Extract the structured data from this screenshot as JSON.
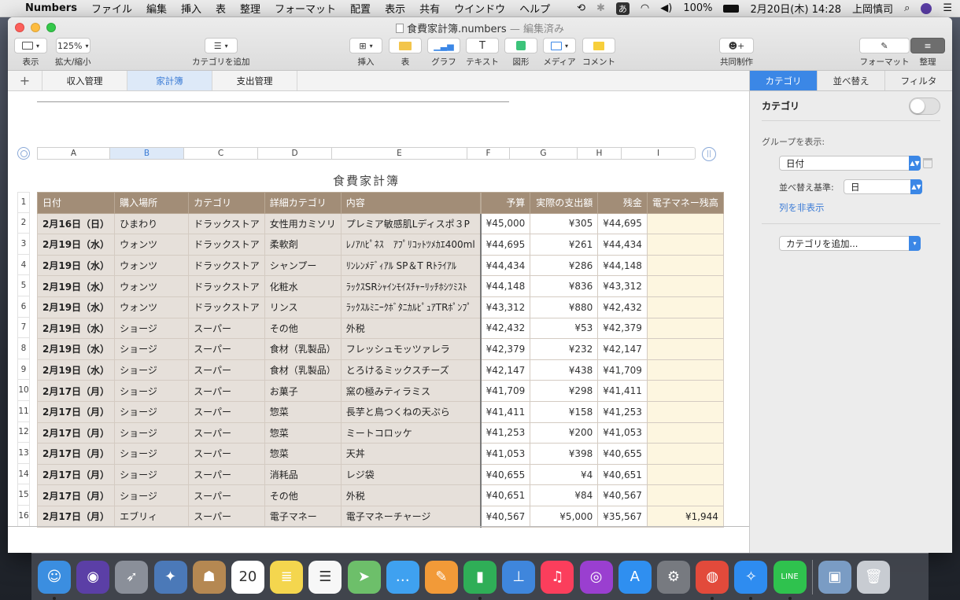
{
  "menubar": {
    "app": "Numbers",
    "items": [
      "ファイル",
      "編集",
      "挿入",
      "表",
      "整理",
      "フォーマット",
      "配置",
      "表示",
      "共有",
      "ウインドウ",
      "ヘルプ"
    ],
    "input_mode": "あ",
    "battery": "100%",
    "datetime": "2月20日(木)  14:28",
    "user": "上岡慎司"
  },
  "window": {
    "title": "食費家計簿.numbers",
    "status": " — 編集済み",
    "toolbar": {
      "view": "表示",
      "zoom_value": "125%",
      "zoom": "拡大/縮小",
      "add_category": "カテゴリを追加",
      "insert": "挿入",
      "table": "表",
      "chart": "グラフ",
      "text": "テキスト",
      "shape": "図形",
      "media": "メディア",
      "comment": "コメント",
      "collaborate": "共同制作",
      "format": "フォーマット",
      "organize": "整理"
    }
  },
  "sheets": [
    {
      "label": "収入管理"
    },
    {
      "label": "家計簿"
    },
    {
      "label": "支出管理"
    }
  ],
  "columns": [
    "A",
    "B",
    "C",
    "D",
    "E",
    "F",
    "G",
    "H",
    "I"
  ],
  "table": {
    "title": "食費家計簿",
    "headers": [
      "日付",
      "購入場所",
      "カテゴリ",
      "詳細カテゴリ",
      "内容",
      "予算",
      "実際の支出額",
      "残金",
      "電子マネー残高"
    ],
    "rows": [
      [
        "2月16日（日）",
        "ひまわり",
        "ドラックストア",
        "女性用カミソリ",
        "プレミア敏感肌Lディスポ３P",
        "¥45,000",
        "¥305",
        "¥44,695",
        ""
      ],
      [
        "2月19日（水）",
        "ウォンツ",
        "ドラックストア",
        "柔軟剤",
        "ﾚﾉｱﾊﾋﾟﾈｽ　ｱﾌﾟﾘｺｯﾄﾂﾒｶｴ400ml",
        "¥44,695",
        "¥261",
        "¥44,434",
        ""
      ],
      [
        "2月19日（水）",
        "ウォンツ",
        "ドラックストア",
        "シャンプー",
        "ﾘﾝﾚﾝﾒﾃﾞｨｱﾙ SP＆T Rﾄﾗｲｱﾙ",
        "¥44,434",
        "¥286",
        "¥44,148",
        ""
      ],
      [
        "2月19日（水）",
        "ウォンツ",
        "ドラックストア",
        "化粧水",
        "ﾗｯｸｽSRｼｬｲﾝﾓｲｽﾁｬｰﾘｯﾁﾎｼﾂﾐｽﾄ",
        "¥44,148",
        "¥836",
        "¥43,312",
        ""
      ],
      [
        "2月19日（水）",
        "ウォンツ",
        "ドラックストア",
        "リンス",
        "ﾗｯｸｽﾙﾐﾆｰｸﾎﾞﾀﾆｶﾙﾋﾟｭｱTRﾎﾟﾝﾌﾟ",
        "¥43,312",
        "¥880",
        "¥42,432",
        ""
      ],
      [
        "2月19日（水）",
        "ショージ",
        "スーパー",
        "その他",
        "外税",
        "¥42,432",
        "¥53",
        "¥42,379",
        ""
      ],
      [
        "2月19日（水）",
        "ショージ",
        "スーパー",
        "食材（乳製品）",
        "フレッシュモッツァレラ",
        "¥42,379",
        "¥232",
        "¥42,147",
        ""
      ],
      [
        "2月19日（水）",
        "ショージ",
        "スーパー",
        "食材（乳製品）",
        "とろけるミックスチーズ",
        "¥42,147",
        "¥438",
        "¥41,709",
        ""
      ],
      [
        "2月17日（月）",
        "ショージ",
        "スーパー",
        "お菓子",
        "窯の極みティラミス",
        "¥41,709",
        "¥298",
        "¥41,411",
        ""
      ],
      [
        "2月17日（月）",
        "ショージ",
        "スーパー",
        "惣菜",
        "長芋と鳥つくねの天ぷら",
        "¥41,411",
        "¥158",
        "¥41,253",
        ""
      ],
      [
        "2月17日（月）",
        "ショージ",
        "スーパー",
        "惣菜",
        "ミートコロッケ",
        "¥41,253",
        "¥200",
        "¥41,053",
        ""
      ],
      [
        "2月17日（月）",
        "ショージ",
        "スーパー",
        "惣菜",
        "天丼",
        "¥41,053",
        "¥398",
        "¥40,655",
        ""
      ],
      [
        "2月17日（月）",
        "ショージ",
        "スーパー",
        "消耗品",
        "レジ袋",
        "¥40,655",
        "¥4",
        "¥40,651",
        ""
      ],
      [
        "2月17日（月）",
        "ショージ",
        "スーパー",
        "その他",
        "外税",
        "¥40,651",
        "¥84",
        "¥40,567",
        ""
      ],
      [
        "2月17日（月）",
        "エブリィ",
        "スーパー",
        "電子マネー",
        "電子マネーチャージ",
        "¥40,567",
        "¥5,000",
        "¥35,567",
        "¥1,944"
      ]
    ]
  },
  "panel": {
    "tabs": [
      "カテゴリ",
      "並べ替え",
      "フィルタ"
    ],
    "category_label": "カテゴリ",
    "group_show": "グループを表示:",
    "group_value": "日付",
    "sort_label": "並べ替え基準:",
    "sort_value": "日",
    "hide_column": "列を非表示",
    "add_category": "カテゴリを追加..."
  },
  "dock": {
    "apps": [
      {
        "name": "finder-icon",
        "color": "#3b8ee0",
        "glyph": "☺",
        "running": true
      },
      {
        "name": "siri-icon",
        "color": "#5b3fa6",
        "glyph": "◉",
        "running": false
      },
      {
        "name": "launchpad-icon",
        "color": "#8a8f99",
        "glyph": "➶",
        "running": false
      },
      {
        "name": "preview-bird-icon",
        "color": "#4b79b8",
        "glyph": "✦",
        "running": false
      },
      {
        "name": "contacts-icon",
        "color": "#b58852",
        "glyph": "☗",
        "running": false
      },
      {
        "name": "calendar-icon",
        "color": "#ffffff",
        "glyph": "20",
        "running": false
      },
      {
        "name": "notes-icon",
        "color": "#f4d64e",
        "glyph": "≣",
        "running": false
      },
      {
        "name": "reminders-icon",
        "color": "#f7f7f7",
        "glyph": "☰",
        "running": false
      },
      {
        "name": "maps-icon",
        "color": "#6dbf6a",
        "glyph": "➤",
        "running": false
      },
      {
        "name": "messages-icon",
        "color": "#3fa1f0",
        "glyph": "…",
        "running": false
      },
      {
        "name": "pages-icon",
        "color": "#f29a38",
        "glyph": "✎",
        "running": false
      },
      {
        "name": "numbers-icon",
        "color": "#2fae57",
        "glyph": "▮",
        "running": true
      },
      {
        "name": "keynote-icon",
        "color": "#3f86dc",
        "glyph": "⊥",
        "running": false
      },
      {
        "name": "music-icon",
        "color": "#fb3e5c",
        "glyph": "♫",
        "running": false
      },
      {
        "name": "podcasts-icon",
        "color": "#9a3fd0",
        "glyph": "◎",
        "running": false
      },
      {
        "name": "app-store-icon",
        "color": "#2f8ff0",
        "glyph": "A",
        "running": false
      },
      {
        "name": "system-preferences-icon",
        "color": "#777a80",
        "glyph": "⚙",
        "running": false
      },
      {
        "name": "chrome-icon",
        "color": "#e24a3b",
        "glyph": "◍",
        "running": true
      },
      {
        "name": "safari-icon",
        "color": "#2e8cf0",
        "glyph": "✧",
        "running": true
      },
      {
        "name": "line-icon",
        "color": "#2fc24e",
        "glyph": "LINE",
        "running": true
      }
    ],
    "others": [
      {
        "name": "photo-viewer-icon",
        "color": "#7a9cc4",
        "glyph": "▣"
      },
      {
        "name": "trash-icon",
        "color": "#c8ccd2",
        "glyph": "🗑"
      }
    ]
  }
}
